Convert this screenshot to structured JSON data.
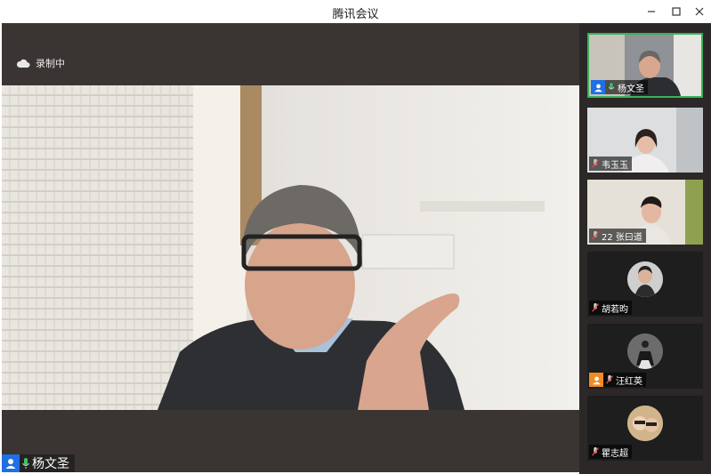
{
  "window": {
    "title": "腾讯会议",
    "controls": [
      "minimize",
      "maximize",
      "close"
    ]
  },
  "main_stage": {
    "recording_label": "录制中",
    "speaker_name": "杨文圣"
  },
  "participants": [
    {
      "name": "杨文圣",
      "has_video": true,
      "active": true,
      "avatar_badge": true,
      "badge_color": "#1f6fe5",
      "mic": "on"
    },
    {
      "name": "韦玉玉",
      "has_video": true,
      "active": false,
      "avatar_badge": false,
      "mic": "muted"
    },
    {
      "name": "22 张曰道",
      "has_video": true,
      "active": false,
      "avatar_badge": false,
      "mic": "muted"
    },
    {
      "name": "胡若昀",
      "has_video": false,
      "active": false,
      "avatar_badge": false,
      "mic": "muted"
    },
    {
      "name": "汪红英",
      "has_video": false,
      "active": false,
      "avatar_badge": true,
      "badge_color": "#f08a24",
      "mic": "muted"
    },
    {
      "name": "瞿志超",
      "has_video": false,
      "active": false,
      "avatar_badge": false,
      "mic": "muted"
    }
  ],
  "colors": {
    "active_border": "#38b35a",
    "mic_on": "#3cc464",
    "mic_muted": "#e84a4a",
    "stage_bg": "#3a3532",
    "sidebar_bg": "#2b2827"
  }
}
